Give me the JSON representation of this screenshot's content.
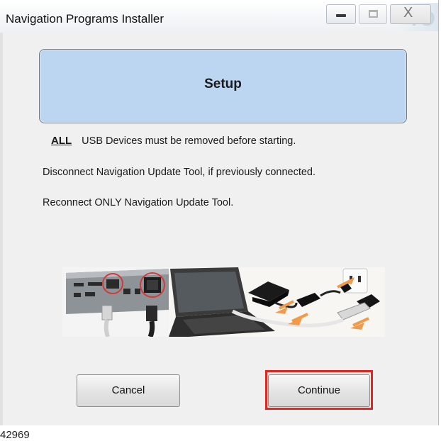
{
  "window": {
    "title": "Navigation Programs Installer",
    "ghost_text": "TO",
    "controls": {
      "minimize": "minimize-icon",
      "maximize": "maximize-icon",
      "close": "close-icon",
      "close_glyph": "X"
    }
  },
  "setup": {
    "title": "Setup"
  },
  "instructions": {
    "line1_emphasis": "ALL",
    "line1_text": "USB Devices must be removed before starting.",
    "line2": "Disconnect Navigation Update Tool, if previously connected.",
    "line3": "Reconnect ONLY Navigation Update Tool."
  },
  "illustration": {
    "icon": "usb-connection-illustration"
  },
  "buttons": {
    "cancel": "Cancel",
    "continue": "Continue"
  },
  "highlight_color": "#e5231f",
  "footnote": "42969"
}
